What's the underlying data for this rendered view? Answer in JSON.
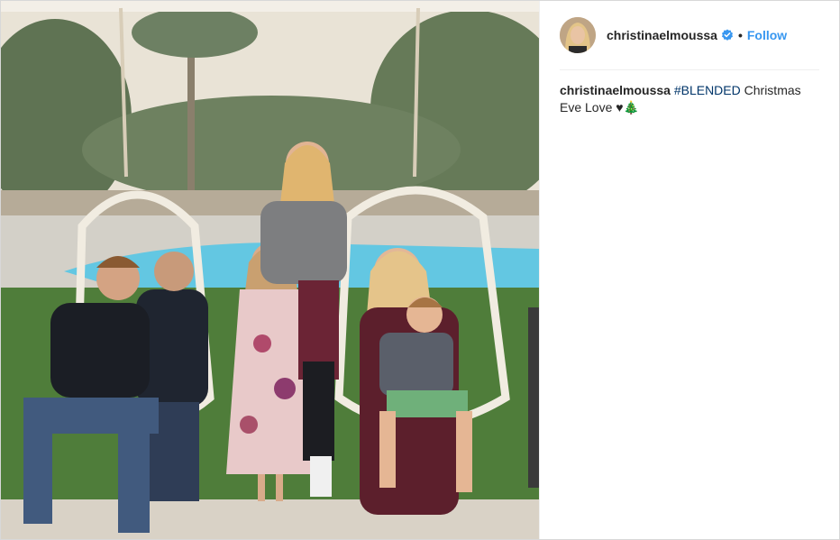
{
  "post": {
    "username": "christinaelmoussa",
    "separator": "•",
    "follow_label": "Follow",
    "caption": {
      "username": "christinaelmoussa",
      "hashtag": "#BLENDED",
      "text": " Christmas Eve Love ♥🎄"
    },
    "colors": {
      "follow": "#3897f0",
      "hashtag": "#003569",
      "verified": "#3897f0",
      "text": "#262626"
    },
    "icons": {
      "verified": "verified-badge-icon",
      "avatar": "profile-photo"
    }
  }
}
